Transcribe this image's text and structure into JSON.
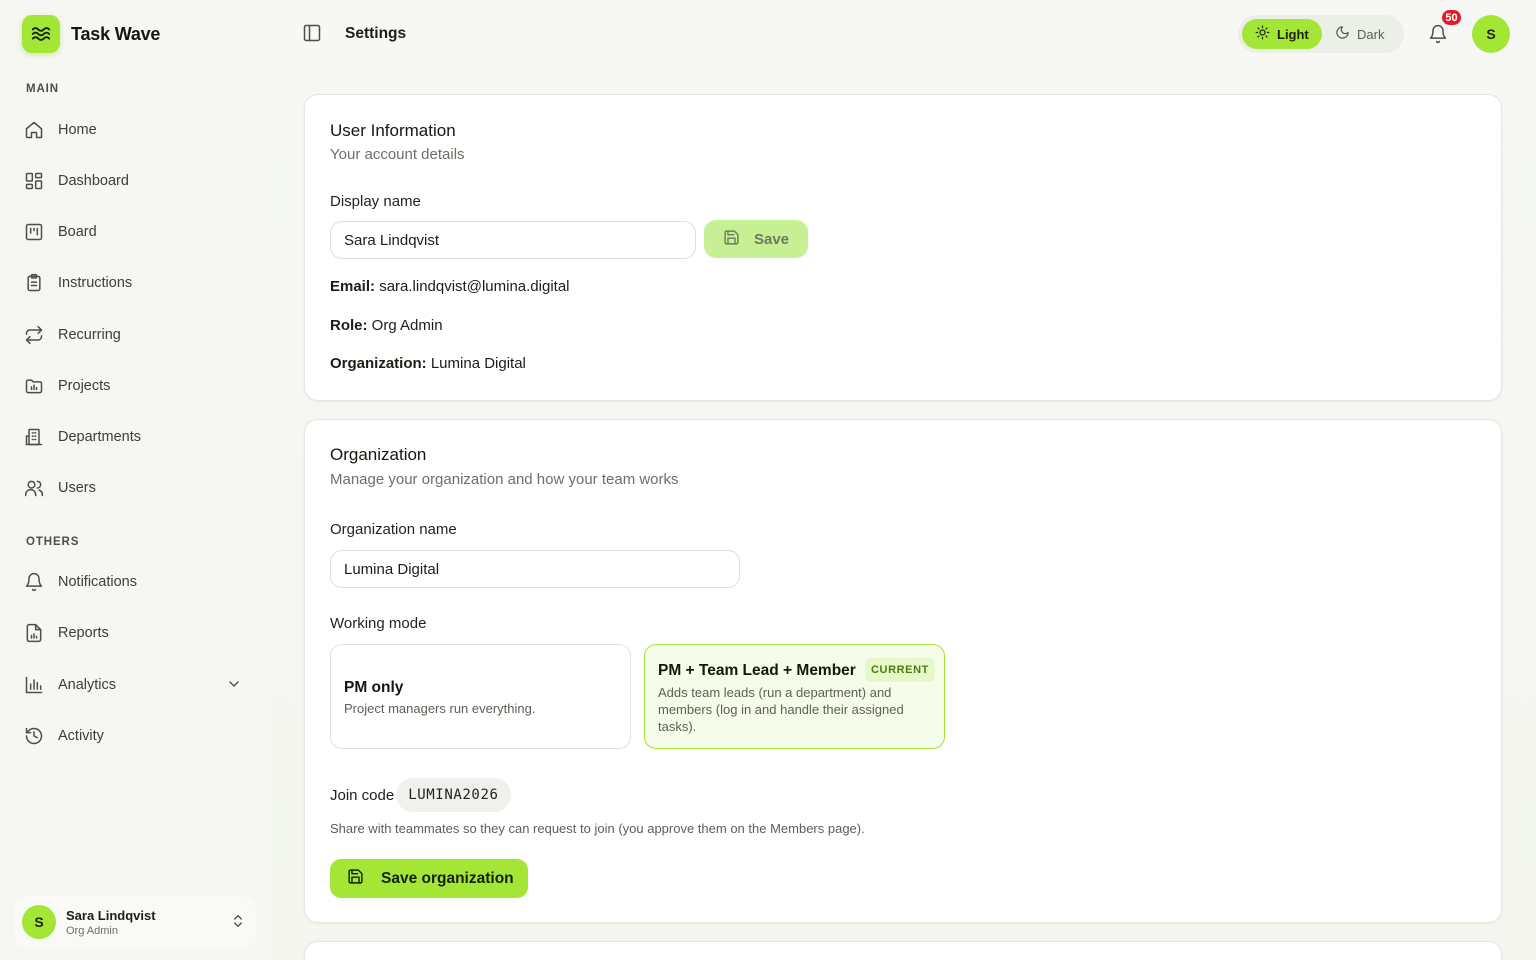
{
  "app": {
    "name": "Task Wave",
    "logo_icon": "waves-icon"
  },
  "sidebar": {
    "main_label": "MAIN",
    "others_label": "OTHERS",
    "main_items": [
      {
        "label": "Home",
        "icon": "home-icon"
      },
      {
        "label": "Dashboard",
        "icon": "dashboard-icon"
      },
      {
        "label": "Board",
        "icon": "board-icon"
      },
      {
        "label": "Instructions",
        "icon": "clipboard-icon"
      },
      {
        "label": "Recurring",
        "icon": "repeat-icon"
      },
      {
        "label": "Projects",
        "icon": "folder-chart-icon"
      },
      {
        "label": "Departments",
        "icon": "building-icon"
      },
      {
        "label": "Users",
        "icon": "users-icon"
      }
    ],
    "other_items": [
      {
        "label": "Notifications",
        "icon": "bell-icon"
      },
      {
        "label": "Reports",
        "icon": "report-icon"
      },
      {
        "label": "Analytics",
        "icon": "bar-chart-icon"
      },
      {
        "label": "Activity",
        "icon": "history-icon"
      }
    ],
    "user": {
      "initial": "S",
      "name": "Sara Lindqvist",
      "role": "Org Admin"
    }
  },
  "topbar": {
    "title": "Settings",
    "theme_light": "Light",
    "theme_dark": "Dark",
    "notification_count": "50",
    "avatar_initial": "S"
  },
  "user_info": {
    "title": "User Information",
    "subtitle": "Your account details",
    "display_name_label": "Display name",
    "display_name_value": "Sara Lindqvist",
    "save_label": "Save",
    "email_label": "Email:",
    "email_value": "sara.lindqvist@lumina.digital",
    "role_label": "Role:",
    "role_value": "Org Admin",
    "org_label": "Organization:",
    "org_value": "Lumina Digital"
  },
  "organization": {
    "title": "Organization",
    "subtitle": "Manage your organization and how your team works",
    "name_label": "Organization name",
    "name_value": "Lumina Digital",
    "working_mode_label": "Working mode",
    "modes": [
      {
        "title": "PM only",
        "desc": "Project managers run everything."
      },
      {
        "title": "PM + Team Lead + Member",
        "tag": "CURRENT",
        "desc": "Adds team leads (run a department) and members (log in and handle their assigned tasks)."
      }
    ],
    "join_code_label": "Join code",
    "join_code_value": "LUMINA2026",
    "join_help": "Share with teammates so they can request to join (you approve them on the Members page).",
    "save_label": "Save organization"
  },
  "colors": {
    "accent": "#a3e635",
    "badge": "#e11d2a"
  }
}
